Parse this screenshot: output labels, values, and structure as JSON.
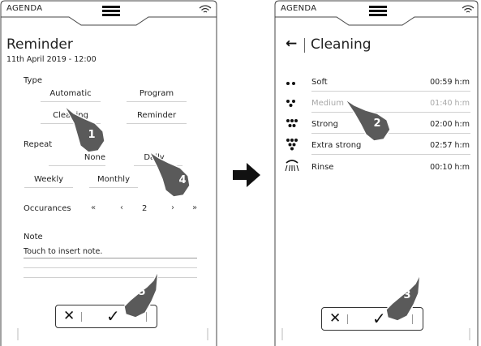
{
  "left_screen": {
    "header_label": "AGENDA",
    "title": "Reminder",
    "datetime": "11th April 2019 - 12:00",
    "type_label": "Type",
    "type_options": [
      "Automatic",
      "Program",
      "Cleaning",
      "Reminder"
    ],
    "repeat_label": "Repeat",
    "repeat_options": [
      "None",
      "Daily",
      "Weekly",
      "Monthly"
    ],
    "occurrences_label": "Occurances",
    "occurrences_value": "2",
    "occurrences_controls": [
      "«",
      "‹",
      "›",
      "»"
    ],
    "note_label": "Note",
    "note_placeholder": "Touch to insert note.",
    "cancel_icon": "✕",
    "confirm_icon": "✓"
  },
  "right_screen": {
    "header_label": "AGENDA",
    "back_icon": "←",
    "title": "Cleaning",
    "items": [
      {
        "label": "Soft",
        "time": "00:59 h:m",
        "icon": "two-drops-icon",
        "dimmed": false
      },
      {
        "label": "Medium",
        "time": "01:40 h:m",
        "icon": "three-drops-icon",
        "dimmed": true
      },
      {
        "label": "Strong",
        "time": "02:00 h:m",
        "icon": "five-drops-icon",
        "dimmed": false
      },
      {
        "label": "Extra strong",
        "time": "02:57 h:m",
        "icon": "seven-drops-icon",
        "dimmed": false
      },
      {
        "label": "Rinse",
        "time": "00:10 h:m",
        "icon": "shower-icon",
        "dimmed": false
      }
    ],
    "cancel_icon": "✕",
    "confirm_icon": "✓"
  },
  "step_numbers": [
    "1",
    "2",
    "3",
    "4",
    "5"
  ],
  "arrow_icon": "right-arrow-icon",
  "colors": {
    "badge": "#5a5a5a",
    "hand": "#5a5a5a",
    "dimmed_text": "#a8a8a8"
  }
}
